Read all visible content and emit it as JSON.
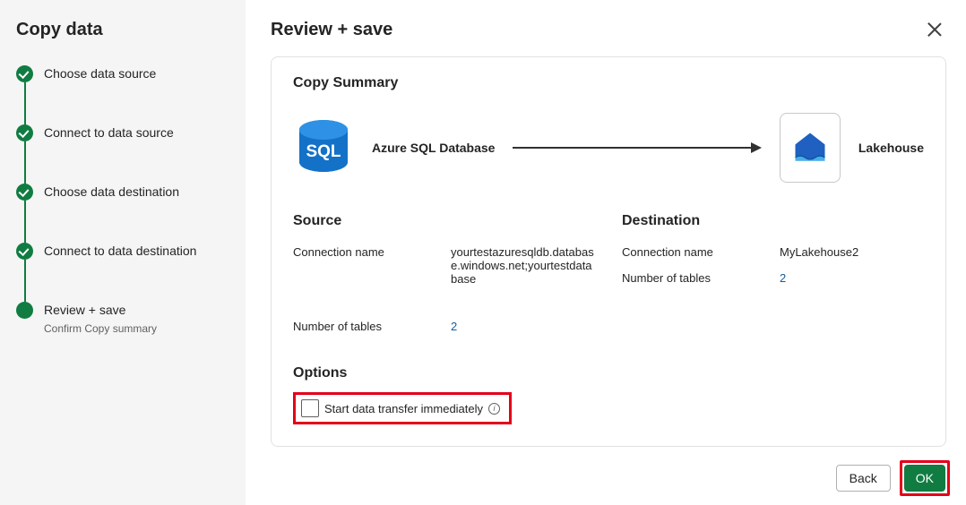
{
  "sidebar": {
    "title": "Copy data",
    "steps": [
      {
        "label": "Choose data source",
        "done": true
      },
      {
        "label": "Connect to data source",
        "done": true
      },
      {
        "label": "Choose data destination",
        "done": true
      },
      {
        "label": "Connect to data destination",
        "done": true
      },
      {
        "label": "Review + save",
        "sub": "Confirm Copy summary",
        "current": true
      }
    ]
  },
  "main": {
    "title": "Review + save",
    "card_title": "Copy Summary",
    "source_service": "Azure SQL Database",
    "dest_service": "Lakehouse",
    "source": {
      "header": "Source",
      "rows": [
        {
          "key": "Connection name",
          "val": "yourtestazuresqldb.database.windows.net;yourtestdatabase",
          "link": false
        },
        {
          "key": "Number of tables",
          "val": "2",
          "link": true
        }
      ]
    },
    "destination": {
      "header": "Destination",
      "rows": [
        {
          "key": "Connection name",
          "val": "MyLakehouse2",
          "link": false
        },
        {
          "key": "Number of tables",
          "val": "2",
          "link": true
        }
      ]
    },
    "options": {
      "header": "Options",
      "start_label": "Start data transfer immediately"
    },
    "buttons": {
      "back": "Back",
      "ok": "OK"
    }
  },
  "colors": {
    "accent": "#107C41",
    "highlight": "#E3001A",
    "link": "#115EA3"
  }
}
